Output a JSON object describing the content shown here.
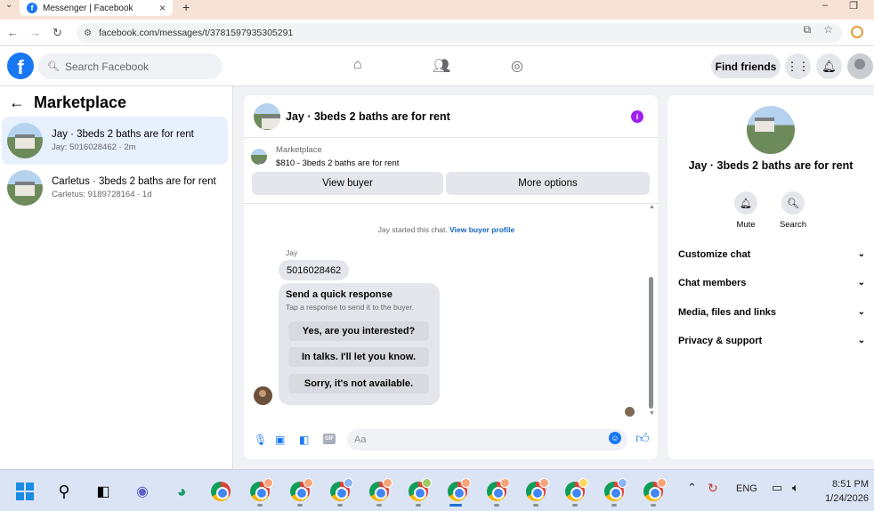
{
  "browser": {
    "tab_title": "Messenger | Facebook",
    "url": "facebook.com/messages/t/3781597935305291"
  },
  "header": {
    "search_placeholder": "Search Facebook",
    "find_friends": "Find friends"
  },
  "left_panel": {
    "title": "Marketplace",
    "conversations": [
      {
        "title": "Jay · 3beds 2 baths are for rent",
        "preview": "Jay: 5016028462 · 2m",
        "active": true
      },
      {
        "title": "Carletus · 3beds 2 baths are for rent",
        "preview": "Carletus: 9189728164 · 1d",
        "active": false
      }
    ]
  },
  "chat": {
    "title": "Jay · 3beds 2 baths are for rent",
    "marketplace_label": "Marketplace",
    "listing": "$810 - 3beds 2 baths are for rent",
    "view_buyer": "View buyer",
    "more_options": "More options",
    "started_text": "Jay started this chat.",
    "view_buyer_profile": "View buyer profile",
    "sender_name": "Jay",
    "message": "5016028462",
    "quick_response": {
      "title": "Send a quick response",
      "subtitle": "Tap a response to send it to the buyer.",
      "options": [
        "Yes, are you interested?",
        "In talks. I'll let you know.",
        "Sorry, it's not available."
      ]
    },
    "composer_placeholder": "Aa"
  },
  "right_panel": {
    "title": "Jay · 3beds 2 baths are for rent",
    "actions": [
      "Mute",
      "Search"
    ],
    "sections": [
      "Customize chat",
      "Chat members",
      "Media, files and links",
      "Privacy & support"
    ]
  },
  "taskbar": {
    "language": "ENG",
    "time": "8:51 PM",
    "date": "1/24/2026"
  },
  "colors": {
    "accent": "#1877f2",
    "active_conversation": "#e7f0fd",
    "info_icon": "#a020f0"
  }
}
